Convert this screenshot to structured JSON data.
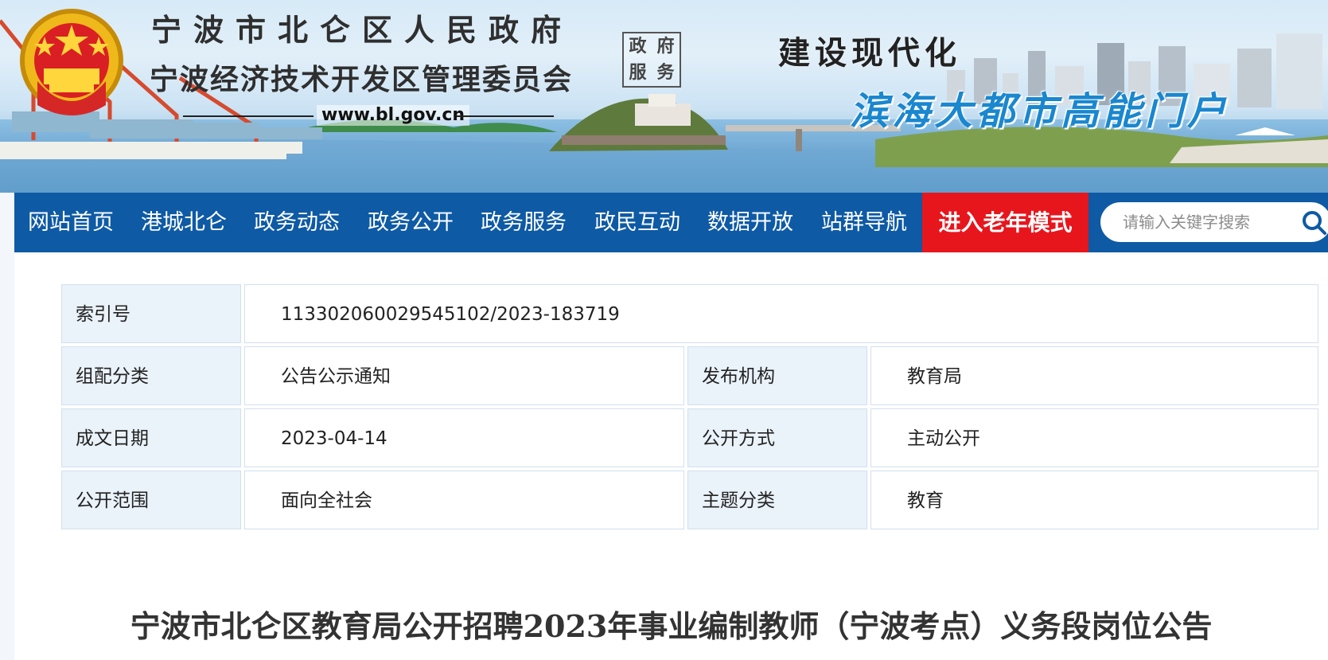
{
  "header": {
    "gov_name": "宁波市北仑区人民政府",
    "committee_name": "宁波经济技术开发区管理委员会",
    "url": "www.bl.gov.cn",
    "seal_chars": [
      "政",
      "府",
      "服",
      "务"
    ],
    "slogan_top": "建设现代化",
    "slogan_bottom": "滨海大都市高能门户",
    "emblem_icon": "national-emblem-icon"
  },
  "nav": {
    "items": [
      {
        "label": "网站首页"
      },
      {
        "label": "港城北仑"
      },
      {
        "label": "政务动态"
      },
      {
        "label": "政务公开"
      },
      {
        "label": "政务服务"
      },
      {
        "label": "政民互动"
      },
      {
        "label": "数据开放"
      },
      {
        "label": "站群导航"
      }
    ],
    "elder_mode_label": "进入老年模式",
    "search_placeholder": "请输入关键字搜索",
    "search_icon": "search-icon"
  },
  "info": {
    "index_no_label": "索引号",
    "index_no_value": "11330206002954510​2/2023-183719",
    "category_label": "组配分类",
    "category_value": "公告公示通知",
    "publisher_label": "发布机构",
    "publisher_value": "教育局",
    "date_label": "成文日期",
    "date_value": "2023-04-14",
    "disclosure_label": "公开方式",
    "disclosure_value": "主动公开",
    "scope_label": "公开范围",
    "scope_value": "面向全社会",
    "topic_label": "主题分类",
    "topic_value": "教育"
  },
  "article": {
    "title": "宁波市北仑区教育局公开招聘2023年事业编制教师（宁波考点）义务段岗位公告"
  },
  "colors": {
    "nav_blue": "#0e5aa5",
    "elder_red": "#e7161d",
    "label_bg": "#eaf2fa",
    "table_border": "#d2e0ee",
    "slogan_blue": "#1a87cf"
  }
}
